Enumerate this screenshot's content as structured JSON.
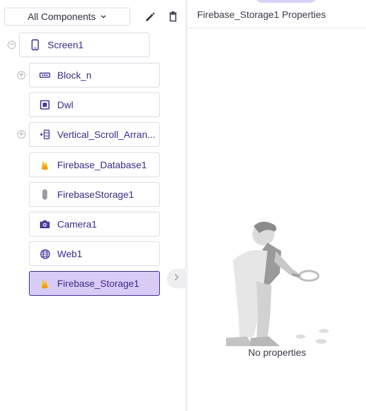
{
  "toolbar": {
    "dropdown_label": "All Components",
    "dropdown_icon": "chevron-down-icon",
    "edit_icon": "pencil-icon",
    "delete_icon": "trash-icon"
  },
  "tree": {
    "items": [
      {
        "label": "Screen1",
        "icon": "phone-icon",
        "toggle": "−",
        "level": 0
      },
      {
        "label": "Block_n",
        "icon": "horizontal-arrangement-icon",
        "toggle": "+",
        "level": 1
      },
      {
        "label": "Dwl",
        "icon": "square-component-icon",
        "toggle": "",
        "level": 1
      },
      {
        "label": "Vertical_Scroll_Arran...",
        "icon": "vertical-scroll-icon",
        "toggle": "+",
        "level": 1
      },
      {
        "label": "Firebase_Database1",
        "icon": "firebase-icon",
        "toggle": "",
        "level": 1
      },
      {
        "label": "FirebaseStorage1",
        "icon": "storage-pill-icon",
        "toggle": "",
        "level": 1
      },
      {
        "label": "Camera1",
        "icon": "camera-icon",
        "toggle": "",
        "level": 1
      },
      {
        "label": "Web1",
        "icon": "globe-icon",
        "toggle": "",
        "level": 1
      },
      {
        "label": "Firebase_Storage1",
        "icon": "firebase-icon",
        "toggle": "",
        "level": 1,
        "selected": true
      }
    ]
  },
  "properties": {
    "title": "Firebase_Storage1 Properties",
    "empty_text": "No properties",
    "illustration": "person-with-magnifier-illustration"
  },
  "colors": {
    "accent": "#3a2a86",
    "selected_bg": "#d8ccf6",
    "icon_purple": "#4b3b9c",
    "firebase_yellow": "#f5c22b",
    "firebase_orange": "#f39a1c"
  }
}
